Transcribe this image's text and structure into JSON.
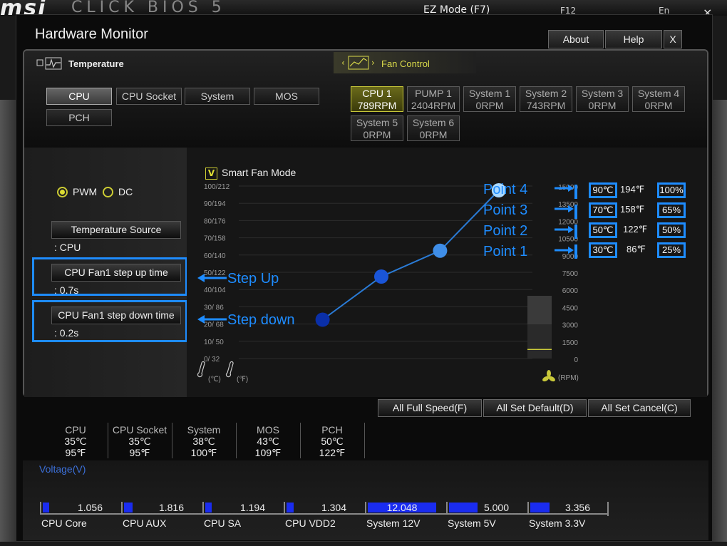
{
  "background": {
    "logo": "msi",
    "subtitle": "CLICK BIOS 5",
    "ez_mode": "EZ Mode (F7)",
    "f12": "F12",
    "lang": "En",
    "close": "×"
  },
  "window": {
    "title": "Hardware Monitor",
    "buttons": {
      "about": "About",
      "help": "Help",
      "close": "X"
    }
  },
  "temperature": {
    "label": "Temperature",
    "sources": [
      "CPU",
      "CPU Socket",
      "System",
      "MOS",
      "PCH"
    ],
    "selected": "CPU"
  },
  "fan_control": {
    "label": "Fan Control",
    "fans": [
      {
        "name": "CPU 1",
        "rpm": "789RPM"
      },
      {
        "name": "PUMP 1",
        "rpm": "2404RPM"
      },
      {
        "name": "System 1",
        "rpm": "0RPM"
      },
      {
        "name": "System 2",
        "rpm": "743RPM"
      },
      {
        "name": "System 3",
        "rpm": "0RPM"
      },
      {
        "name": "System 4",
        "rpm": "0RPM"
      },
      {
        "name": "System 5",
        "rpm": "0RPM"
      },
      {
        "name": "System 6",
        "rpm": "0RPM"
      }
    ],
    "selected": "CPU 1"
  },
  "settings": {
    "pwm": "PWM",
    "dc": "DC",
    "mode": "PWM",
    "temp_source_label": "Temperature Source",
    "temp_source_value": ": CPU",
    "step_up_label": "CPU Fan1 step up time",
    "step_up_value": ": 0.7s",
    "step_down_label": "CPU Fan1 step down time",
    "step_down_value": ": 0.2s"
  },
  "chart_data": {
    "type": "line",
    "smart_fan_mode": "Smart Fan Mode",
    "smart_fan_checked": "V",
    "y_left_ticks": [
      "100/212",
      "90/194",
      "80/176",
      "70/158",
      "60/140",
      "50/122",
      "40/104",
      "30/ 86",
      "20/ 68",
      "10/ 50",
      "0/ 32"
    ],
    "y_right_ticks": [
      "15000",
      "13500",
      "12000",
      "10500",
      "9000",
      "7500",
      "6000",
      "4500",
      "3000",
      "1500",
      "0"
    ],
    "unit_c": "(℃)",
    "unit_f": "(℉)",
    "unit_rpm": "(RPM)",
    "series": [
      {
        "x": [
          30,
          50,
          70,
          90
        ],
        "y": [
          25,
          50,
          65,
          100
        ]
      }
    ],
    "current_rpm": 789,
    "y_range": [
      0,
      100
    ],
    "x_range": [
      0,
      100
    ]
  },
  "points": [
    {
      "label": "Point 4",
      "c": "90℃",
      "f": "194℉",
      "pct": "100%"
    },
    {
      "label": "Point 3",
      "c": "70℃",
      "f": "158℉",
      "pct": "65%"
    },
    {
      "label": "Point 2",
      "c": "50℃",
      "f": "122℉",
      "pct": "50%"
    },
    {
      "label": "Point 1",
      "c": "30℃",
      "f": "86℉",
      "pct": "25%"
    }
  ],
  "annotations": {
    "step_up": "Step Up",
    "step_down": "Step down"
  },
  "bottom_buttons": {
    "full_speed": "All Full Speed(F)",
    "set_default": "All Set Default(D)",
    "set_cancel": "All Set Cancel(C)"
  },
  "temps": [
    {
      "name": "CPU",
      "c": "35℃",
      "f": "95℉"
    },
    {
      "name": "CPU Socket",
      "c": "35℃",
      "f": "95℉"
    },
    {
      "name": "System",
      "c": "38℃",
      "f": "100℉"
    },
    {
      "name": "MOS",
      "c": "43℃",
      "f": "109℉"
    },
    {
      "name": "PCH",
      "c": "50℃",
      "f": "122℉"
    }
  ],
  "voltage": {
    "title": "Voltage(V)",
    "items": [
      {
        "name": "CPU Core",
        "value": "1.056",
        "level": 0.09
      },
      {
        "name": "CPU AUX",
        "value": "1.816",
        "level": 0.13
      },
      {
        "name": "CPU SA",
        "value": "1.194",
        "level": 0.09
      },
      {
        "name": "CPU VDD2",
        "value": "1.304",
        "level": 0.1
      },
      {
        "name": "System 12V",
        "value": "12.048",
        "level": 1.0
      },
      {
        "name": "System 5V",
        "value": "5.000",
        "level": 0.42
      },
      {
        "name": "System 3.3V",
        "value": "3.356",
        "level": 0.28
      }
    ]
  }
}
